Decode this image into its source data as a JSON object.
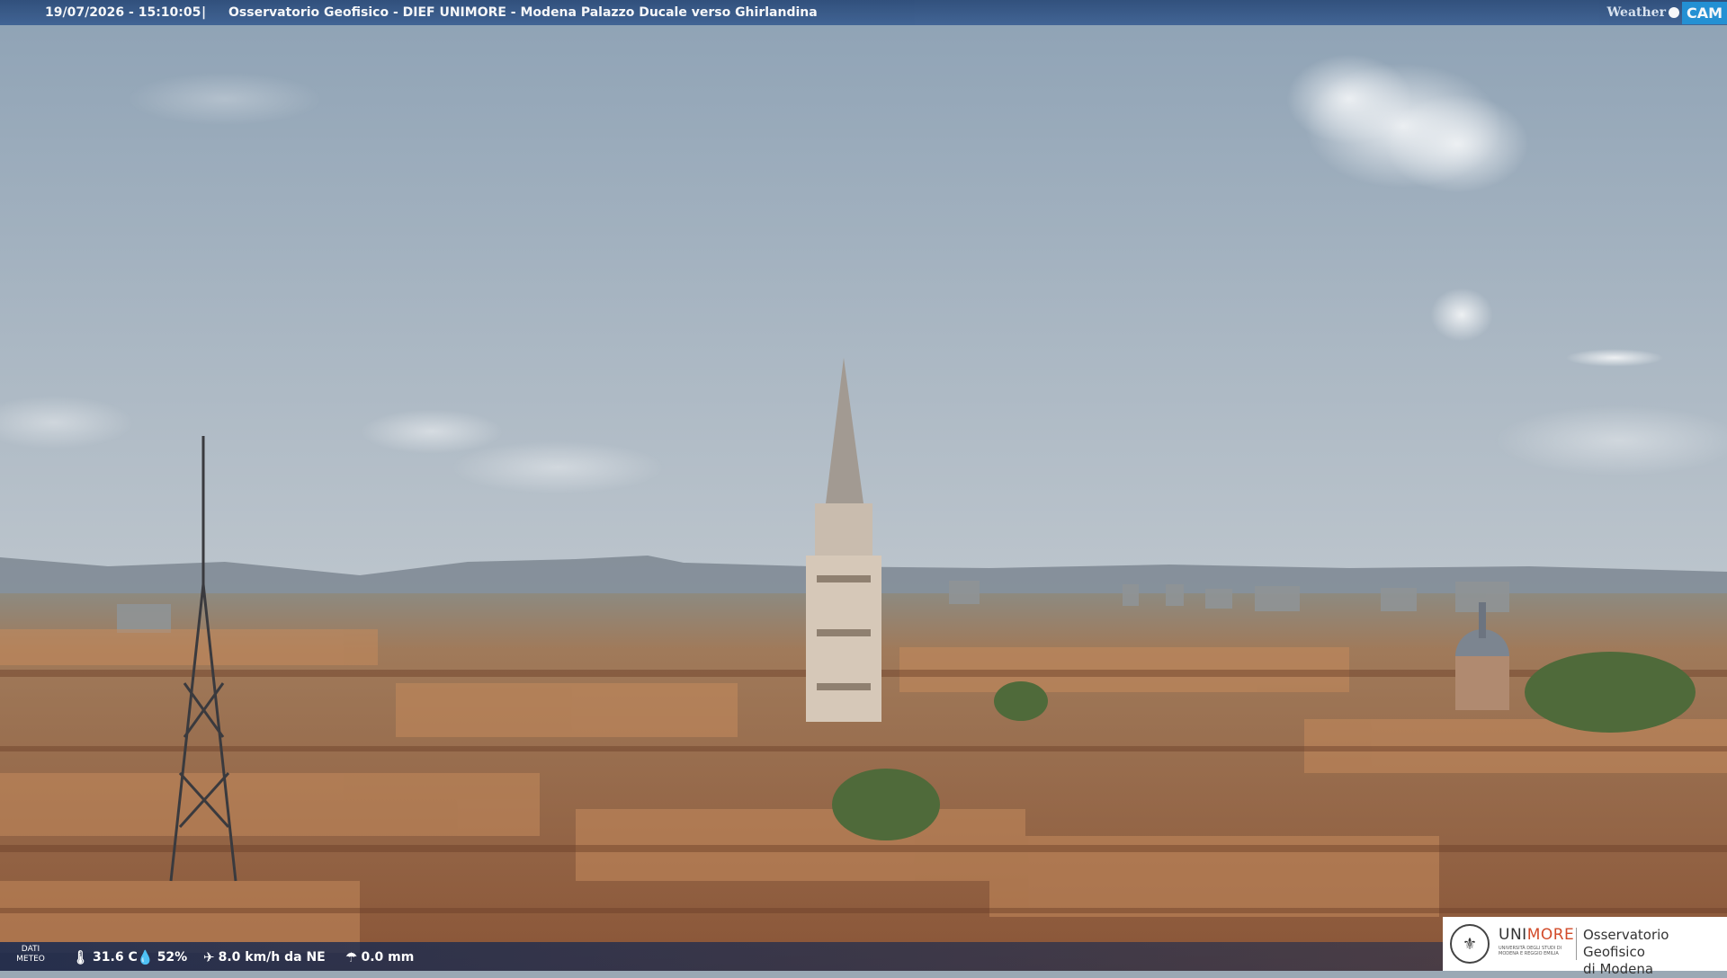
{
  "header": {
    "timestamp": "19/07/2026 - 15:10:05",
    "separator": "|",
    "title": "Osservatorio Geofisico - DIEF UNIMORE - Modena Palazzo Ducale verso Ghirlandina",
    "logo_weather": "Weather",
    "logo_cam": "CAM"
  },
  "weather": {
    "label_line1": "DATI",
    "label_line2": "METEO",
    "temperature": "31.6 C",
    "humidity": "52%",
    "wind": "8.0 km/h da NE",
    "rain": "0.0 mm"
  },
  "institution": {
    "name_prefix": "UNI",
    "name_suffix": "MORE",
    "subtitle": "UNIVERSITÀ DEGLI STUDI DI MODENA E REGGIO EMILIA",
    "observatory_line1": "Osservatorio Geofisico",
    "observatory_line2": "di Modena"
  },
  "icons": [
    "thermometer-icon",
    "humidity-icon",
    "wind-icon",
    "rain-icon"
  ],
  "colors": {
    "bar": "#2f5285",
    "accent": "#d24b2a",
    "roof": "#b5784f",
    "sky": "#a9b8c6"
  }
}
